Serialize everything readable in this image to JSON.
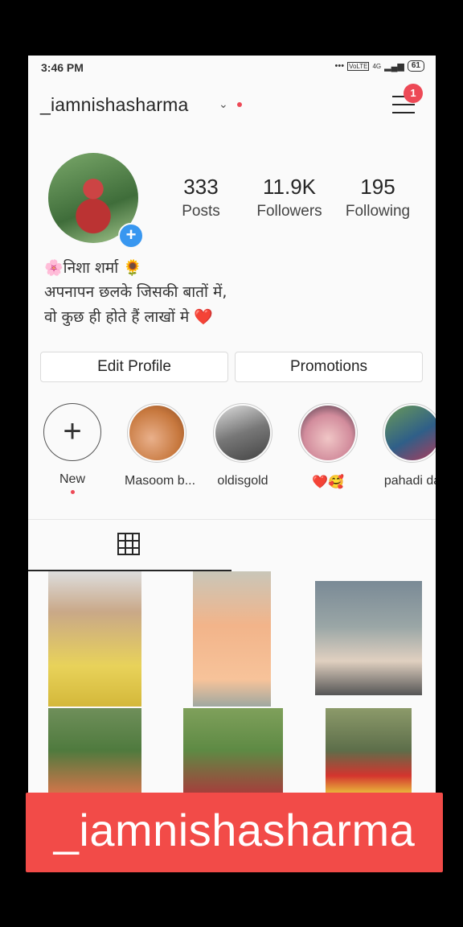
{
  "status_bar": {
    "time": "3:46 PM",
    "network": "4G",
    "volte": "VoLTE",
    "battery": "61"
  },
  "header": {
    "username": "_iamnishasharma",
    "notification_count": "1"
  },
  "profile": {
    "stats": [
      {
        "value": "333",
        "label": "Posts"
      },
      {
        "value": "11.9K",
        "label": "Followers"
      },
      {
        "value": "195",
        "label": "Following"
      }
    ],
    "bio": [
      "🌸निशा शर्मा 🌻",
      "अपनापन छलके जिसकी बातों में,",
      "वो कुछ ही होते हैं लाखों मे ❤️"
    ]
  },
  "buttons": {
    "edit_profile": "Edit Profile",
    "promotions": "Promotions"
  },
  "highlights": [
    {
      "label": "New"
    },
    {
      "label": "Masoom b..."
    },
    {
      "label": "oldisgold"
    },
    {
      "label": "❤️🥰"
    },
    {
      "label": "pahadi da"
    }
  ],
  "tabs": {
    "active": "grid",
    "icons": [
      "grid-icon",
      "tagged-icon"
    ]
  },
  "colors": {
    "accent_blue": "#3897f0",
    "notification_red": "#ed4956",
    "overlay_red": "#f24b48"
  },
  "overlay": {
    "text": "_iamnishasharma"
  }
}
